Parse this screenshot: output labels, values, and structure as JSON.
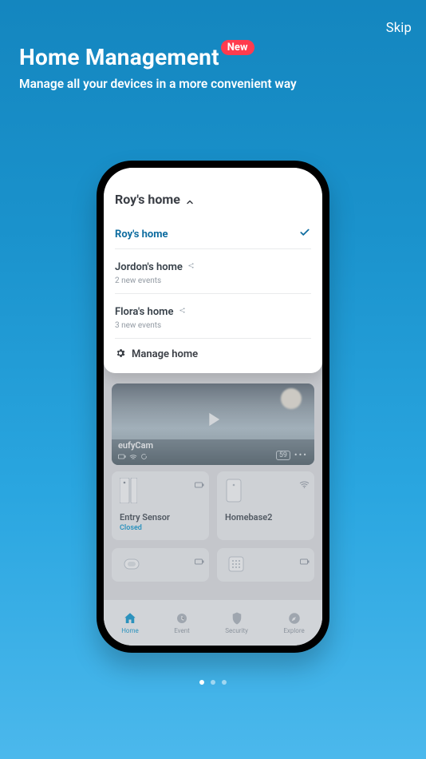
{
  "skip": "Skip",
  "header": {
    "title": "Home Management",
    "badge": "New",
    "subtitle": "Manage all your devices in a more convenient way"
  },
  "popup": {
    "header": "Roy's home",
    "homes": [
      {
        "name": "Roy's home",
        "sub": "",
        "selected": true,
        "shared": false
      },
      {
        "name": "Jordon's home",
        "sub": "2 new events",
        "selected": false,
        "shared": true
      },
      {
        "name": "Flora's home",
        "sub": "3 new events",
        "selected": false,
        "shared": true
      }
    ],
    "manage": "Manage home"
  },
  "camera": {
    "name": "eufyCam",
    "badge": "59"
  },
  "tiles": {
    "entry": {
      "name": "Entry Sensor",
      "status": "Closed"
    },
    "homebase": {
      "name": "Homebase2"
    }
  },
  "tabs": {
    "home": "Home",
    "event": "Event",
    "security": "Security",
    "explore": "Explore"
  },
  "pager": {
    "active": 0,
    "count": 3
  }
}
